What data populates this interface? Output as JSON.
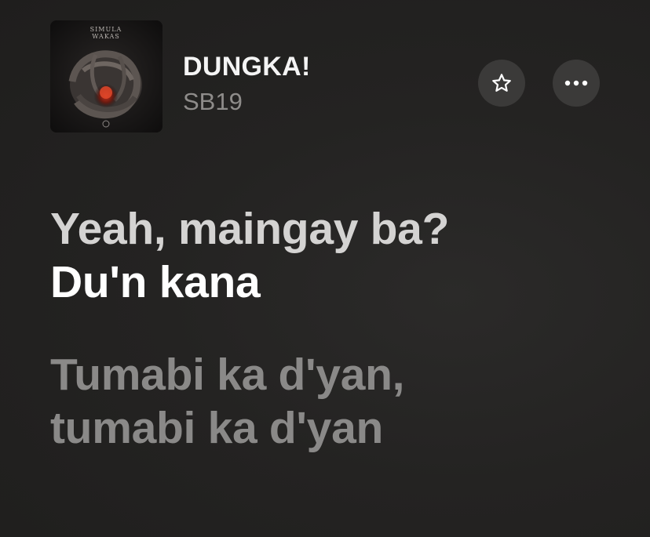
{
  "now_playing": {
    "title": "DUNGKA!",
    "artist": "SB19",
    "album_art": {
      "icon": "album-cover",
      "caption": "SIMULA WAKAS"
    }
  },
  "actions": {
    "favorite_icon": "star-icon",
    "more_icon": "ellipsis-icon"
  },
  "lyrics": {
    "lines": [
      {
        "text": "Yeah, maingay ba?",
        "state": "past"
      },
      {
        "text": "Du'n kana",
        "state": "active"
      },
      {
        "text": "Tumabi ka d'yan,",
        "state": "upcoming"
      },
      {
        "text": "tumabi ka d'yan",
        "state": "upcoming"
      }
    ]
  },
  "colors": {
    "background": "#242322",
    "title": "#f4f4f4",
    "artist": "#8e8c8a",
    "lyric_active": "#ffffff",
    "lyric_past": "#d4d3d2",
    "lyric_upcoming": "#8a8988",
    "button_bg": "#3b3a39"
  }
}
